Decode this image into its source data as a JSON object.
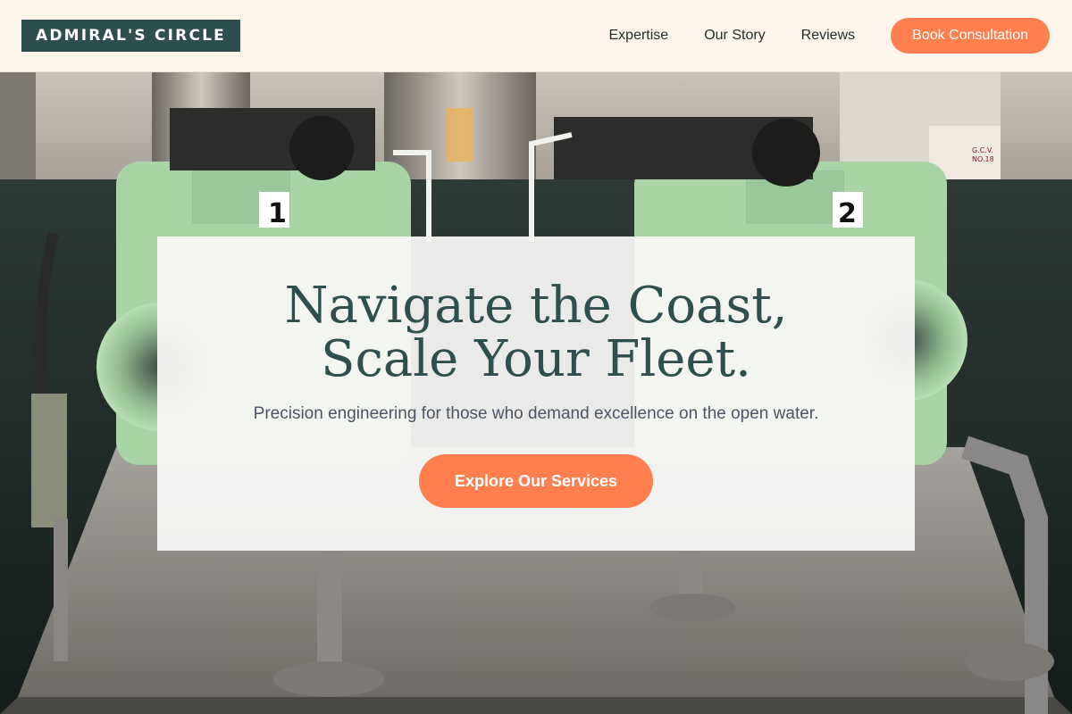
{
  "header": {
    "logo": "ADMIRAL'S CIRCLE",
    "nav": [
      {
        "label": "Expertise"
      },
      {
        "label": "Our Story"
      },
      {
        "label": "Reviews"
      }
    ],
    "cta_label": "Book Consultation"
  },
  "hero": {
    "title": "Navigate the Coast, Scale Your Fleet.",
    "subtitle": "Precision engineering for those who demand excellence on the open water.",
    "cta_label": "Explore Our Services",
    "background_description_tags": {
      "unit_label_1": "1",
      "unit_label_2": "2",
      "wall_plate": "G.C.V. NO.18"
    }
  },
  "colors": {
    "brand_dark": "#2f4f4f",
    "accent": "#ff7f4f",
    "header_bg": "#fef6ea",
    "machine_green": "#a9d4a6"
  }
}
